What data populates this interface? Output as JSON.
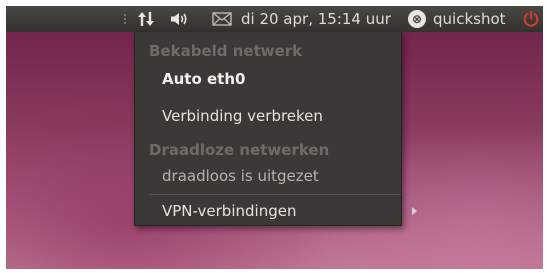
{
  "panel": {
    "clock": "di 20 apr, 15:14 uur",
    "user": "quickshot",
    "user_icon_glyph": "⊗",
    "icons": [
      "network-arrows-icon",
      "volume-icon",
      "mail-icon",
      "power-icon"
    ]
  },
  "network_menu": {
    "wired_header": "Bekabeld netwerk",
    "wired_connection": "Auto eth0",
    "disconnect": "Verbinding verbreken",
    "wireless_header": "Draadloze netwerken",
    "wireless_status": "draadloos is uitgezet",
    "vpn": "VPN-verbindingen"
  },
  "colors": {
    "panel": "#3c3b37",
    "menu": "#3a3935",
    "power_icon": "#d33a2c",
    "desktop": "#8a3a5f"
  }
}
